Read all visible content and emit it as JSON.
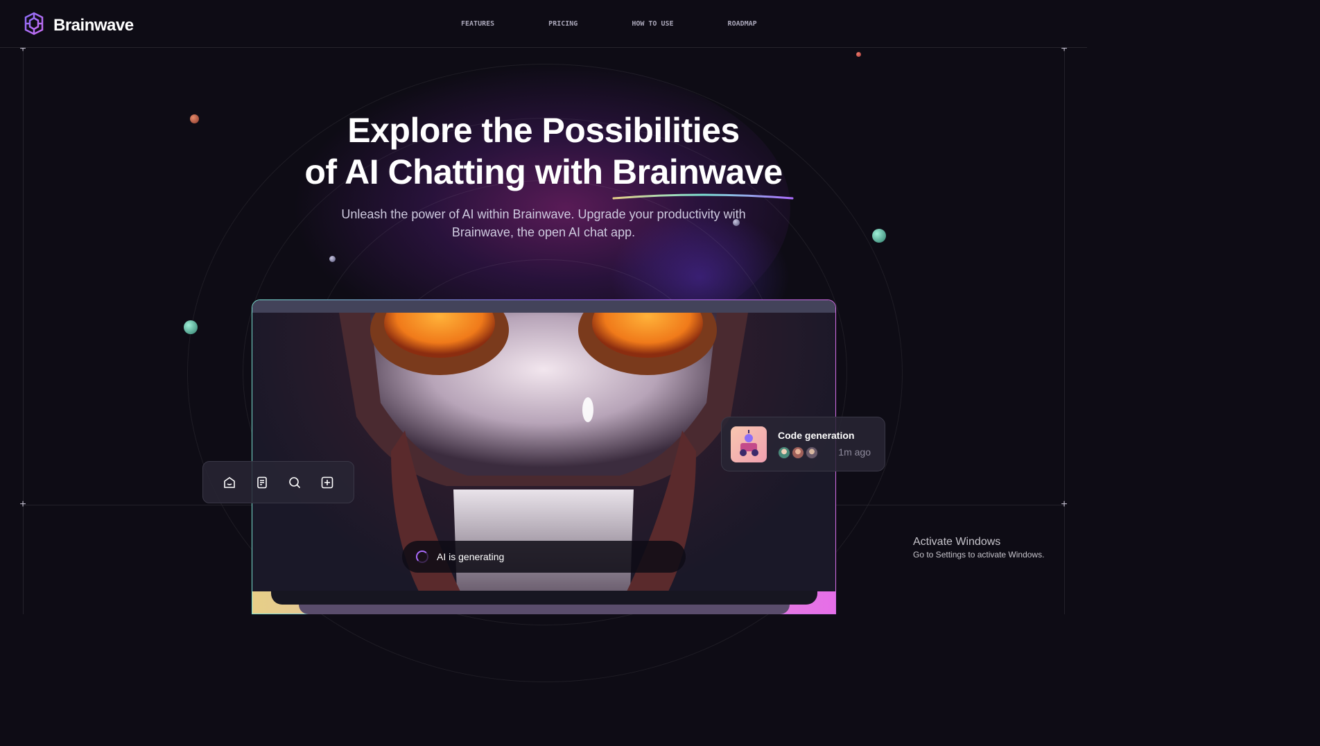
{
  "brand": {
    "name": "Brainwave"
  },
  "nav": [
    "Features",
    "Pricing",
    "How to use",
    "Roadmap"
  ],
  "hero": {
    "title_line1": "Explore the Possibilities",
    "title_line2_prefix": "of AI Chatting with ",
    "title_line2_highlight": "Brainwave",
    "subtitle": "Unleash the power of AI within Brainwave. Upgrade your productivity with Brainwave, the open AI chat app."
  },
  "toolbar": {
    "icons": [
      "home-icon",
      "document-icon",
      "search-icon",
      "add-icon"
    ]
  },
  "card": {
    "title": "Code generation",
    "time": "1m ago"
  },
  "status": {
    "text": "AI is generating"
  },
  "os_notice": {
    "title": "Activate Windows",
    "subtitle": "Go to Settings to activate Windows."
  },
  "colors": {
    "background": "#0e0c15",
    "accent": "#ac6cff",
    "teal": "#7ce3d4",
    "pink": "#d56ee8"
  }
}
